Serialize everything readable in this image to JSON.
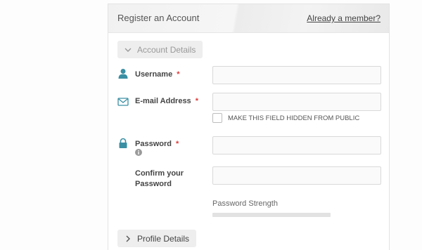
{
  "header": {
    "title": "Register an Account",
    "member_link": "Already a member?"
  },
  "account_section": {
    "label": "Account Details",
    "state": "expanded"
  },
  "fields": {
    "username": {
      "label": "Username",
      "required_mark": "*",
      "value": "",
      "icon": "user-icon"
    },
    "email": {
      "label": "E-mail Address",
      "required_mark": "*",
      "value": "",
      "icon": "envelope-icon"
    },
    "hide_email": {
      "label": "MAKE THIS FIELD HIDDEN FROM PUBLIC",
      "checked": false
    },
    "password": {
      "label": "Password",
      "required_mark": "*",
      "value": "",
      "icon": "lock-icon"
    },
    "confirm_password": {
      "label_line1": "Confirm your",
      "label_line2": "Password",
      "value": ""
    }
  },
  "password_strength": {
    "label": "Password Strength",
    "level": 0
  },
  "profile_section": {
    "label": "Profile Details",
    "state": "collapsed"
  },
  "colors": {
    "icon_teal": "#3a8fa3",
    "required_red": "#e03a3a"
  }
}
